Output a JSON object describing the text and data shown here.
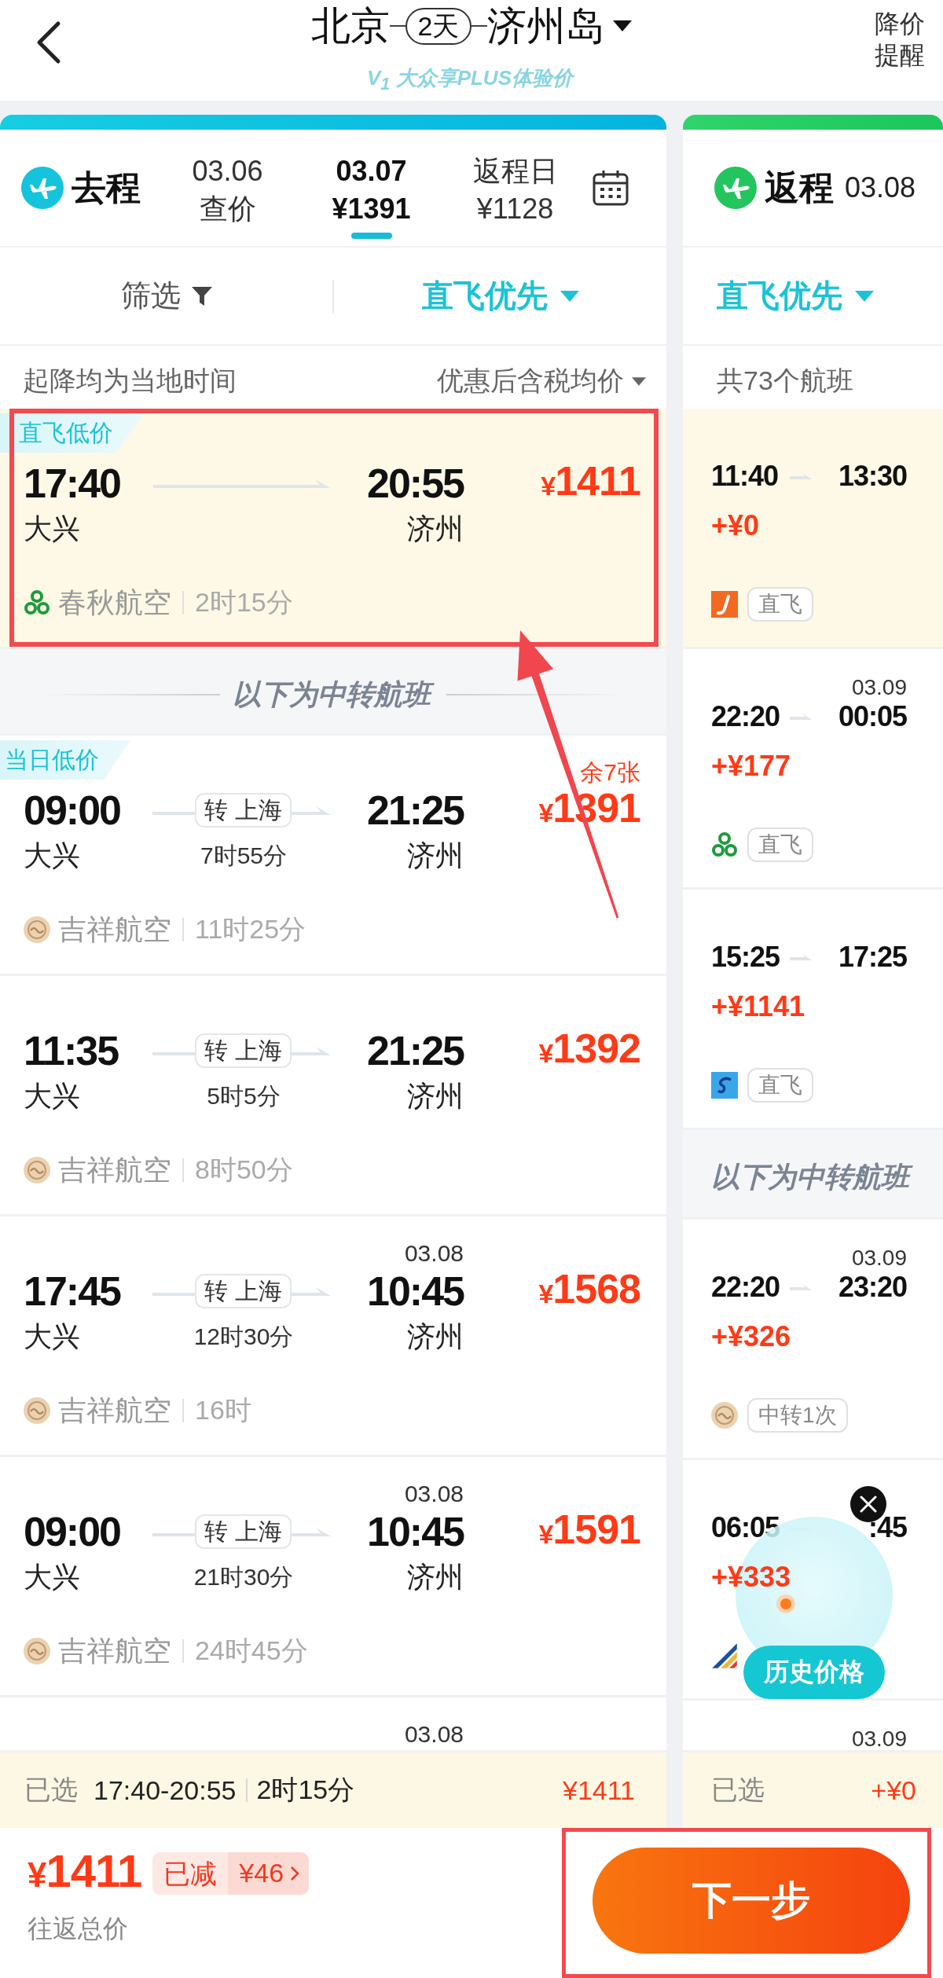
{
  "header": {
    "origin": "北京",
    "trip_length": "2天",
    "destination": "济州岛",
    "subtitle": "V$_{1}$ 大众享PLUS体验价",
    "price_alert": "降价提醒"
  },
  "outbound": {
    "label": "去程",
    "dates": [
      {
        "date": "03.06",
        "price": "查价",
        "selected": false
      },
      {
        "date": "03.07",
        "price": "¥1391",
        "selected": true
      },
      {
        "date": "返程日",
        "price": "¥1128",
        "selected": false
      }
    ],
    "filter": "筛选",
    "sort": "直飞优先",
    "note": "起降均为当地时间",
    "price_note": "优惠后含税均价",
    "items": [
      {
        "kind": "flight",
        "selected": true,
        "marked": true,
        "tag": "直飞低价",
        "departure_time": "17:40",
        "departure_airport": "大兴",
        "arrival_time": "20:55",
        "arrival_airport": "济州",
        "price": "¥1411",
        "logo": {
          "kind": "clover"
        },
        "airline": "春秋航空",
        "duration": "2时15分"
      },
      {
        "kind": "divider",
        "text": "以下为中转航班"
      },
      {
        "kind": "flight",
        "selected": false,
        "marked": false,
        "tag": "当日低价",
        "tickets_left": "余7张",
        "departure_time": "09:00",
        "departure_airport": "大兴",
        "transfer": "转 上海",
        "transfer_duration": "7时55分",
        "arrival_time": "21:25",
        "arrival_airport": "济州",
        "price": "¥1391",
        "logo": {
          "kind": "seal"
        },
        "airline": "吉祥航空",
        "duration": "11时25分"
      },
      {
        "kind": "flight",
        "selected": false,
        "marked": false,
        "departure_time": "11:35",
        "departure_airport": "大兴",
        "transfer": "转 上海",
        "transfer_duration": "5时5分",
        "arrival_time": "21:25",
        "arrival_airport": "济州",
        "price": "¥1392",
        "logo": {
          "kind": "seal"
        },
        "airline": "吉祥航空",
        "duration": "8时50分"
      },
      {
        "kind": "flight",
        "selected": false,
        "marked": false,
        "departure_time": "17:45",
        "departure_airport": "大兴",
        "transfer": "转 上海",
        "transfer_duration": "12时30分",
        "arrival_date": "03.08",
        "arrival_time": "10:45",
        "arrival_airport": "济州",
        "price": "¥1568",
        "logo": {
          "kind": "seal"
        },
        "airline": "吉祥航空",
        "duration": "16时"
      },
      {
        "kind": "flight",
        "selected": false,
        "marked": false,
        "departure_time": "09:00",
        "departure_airport": "大兴",
        "transfer": "转 上海",
        "transfer_duration": "21时30分",
        "arrival_date": "03.08",
        "arrival_time": "10:45",
        "arrival_airport": "济州",
        "price": "¥1591",
        "logo": {
          "kind": "seal"
        },
        "airline": "吉祥航空",
        "duration": "24时45分"
      },
      {
        "kind": "flight",
        "selected": false,
        "marked": false,
        "arrival_date": "03.08"
      }
    ]
  },
  "return": {
    "label": "返程",
    "date": "03.08",
    "sort": "直飞优先",
    "count": "共73个航班",
    "items": [
      {
        "kind": "flight",
        "selected": true,
        "departure_time": "11:40",
        "arrival_time": "13:30",
        "price": "+¥0",
        "logo": {
          "kind": "tile"
        },
        "tag": "直飞"
      },
      {
        "kind": "flight",
        "selected": false,
        "departure_time": "22:20",
        "arrival_date": "03.09",
        "arrival_time": "00:05",
        "price": "+¥177",
        "logo": {
          "kind": "clover"
        },
        "tag": "直飞"
      },
      {
        "kind": "flight",
        "selected": false,
        "departure_time": "15:25",
        "arrival_time": "17:25",
        "price": "+¥1141",
        "logo": {
          "kind": "swirl"
        },
        "tag": "直飞"
      },
      {
        "kind": "divider",
        "text": "以下为中转航班"
      },
      {
        "kind": "flight",
        "selected": false,
        "departure_time": "22:20",
        "arrival_date": "03.09",
        "arrival_time": "23:20",
        "price": "+¥326",
        "logo": {
          "kind": "seal"
        },
        "tag": "中转1次"
      },
      {
        "kind": "flight",
        "selected": false,
        "departure_time": "06:05",
        "arrival_time": ":45",
        "price": "+¥333",
        "logo": {
          "kind": "stripes"
        }
      },
      {
        "kind": "flight",
        "selected": false,
        "arrival_date": "03.09"
      }
    ]
  },
  "selection_bar": {
    "outbound": {
      "label": "已选",
      "time": "17:40-20:55",
      "duration": "2时15分",
      "price": "¥1411"
    },
    "return": {
      "label": "已选",
      "price": "+¥0"
    }
  },
  "footer": {
    "total_price": "¥1411",
    "discount_label": "已减",
    "discount": "¥46",
    "total_label": "往返总价",
    "next_button": {
      "label": "下一步",
      "marked": true
    }
  },
  "history_widget": {
    "label": "历史价格"
  },
  "annotation_arrow": true
}
